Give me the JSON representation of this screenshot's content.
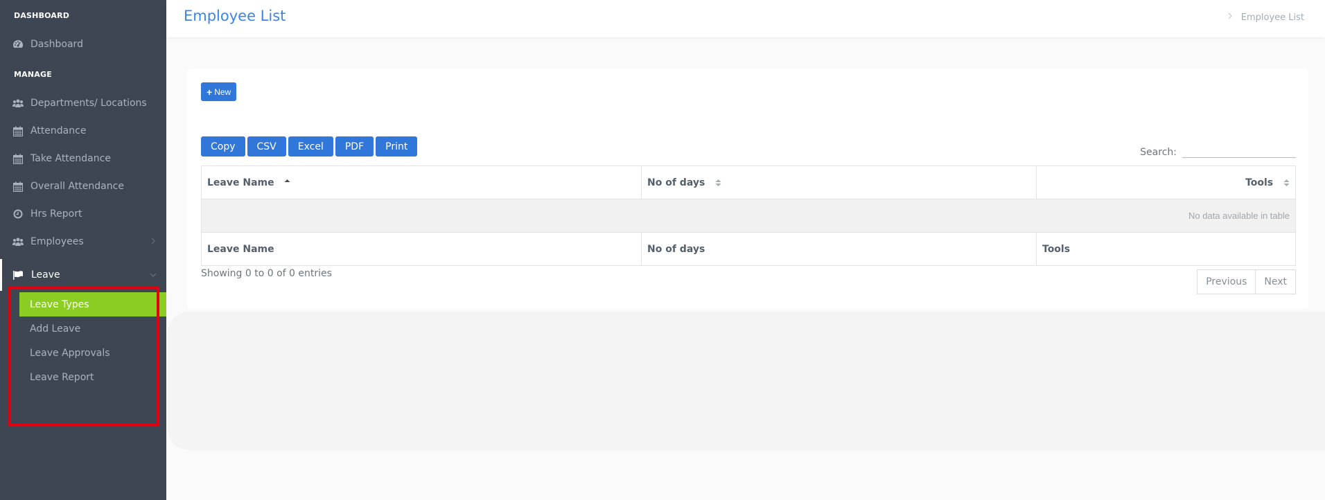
{
  "sidebar": {
    "sections": [
      {
        "label": "DASHBOARD"
      },
      {
        "label": "MANAGE"
      }
    ],
    "items": [
      {
        "label": "Dashboard",
        "icon": "dashboard-icon"
      },
      {
        "label": "Departments/ Locations",
        "icon": "users-icon"
      },
      {
        "label": "Attendance",
        "icon": "calendar-icon"
      },
      {
        "label": "Take Attendance",
        "icon": "calendar-icon"
      },
      {
        "label": "Overall Attendance",
        "icon": "calendar-icon"
      },
      {
        "label": "Hrs Report",
        "icon": "clock-icon"
      },
      {
        "label": "Employees",
        "icon": "users-icon"
      },
      {
        "label": "Leave",
        "icon": "flag-icon"
      }
    ],
    "leave_submenu": [
      {
        "label": "Leave Types",
        "selected": true
      },
      {
        "label": "Add Leave"
      },
      {
        "label": "Leave Approvals"
      },
      {
        "label": "Leave Report"
      }
    ]
  },
  "header": {
    "title": "Employee List",
    "breadcrumb": "Employee List"
  },
  "toolbar": {
    "new_label": "New",
    "export_buttons": [
      "Copy",
      "CSV",
      "Excel",
      "PDF",
      "Print"
    ],
    "search_label": "Search:",
    "search_value": ""
  },
  "table": {
    "columns": [
      "Leave Name",
      "No of days",
      "Tools"
    ],
    "empty_message": "No data available in table",
    "footer_columns": [
      "Leave Name",
      "No of days",
      "Tools"
    ]
  },
  "pagination": {
    "info": "Showing 0 to 0 of 0 entries",
    "previous": "Previous",
    "next": "Next"
  },
  "colors": {
    "sidebar_bg": "#3d4652",
    "accent_green": "#8ccd24",
    "primary_blue": "#3077d9",
    "title_blue": "#3a86e8",
    "highlight_red": "#e3000f"
  }
}
